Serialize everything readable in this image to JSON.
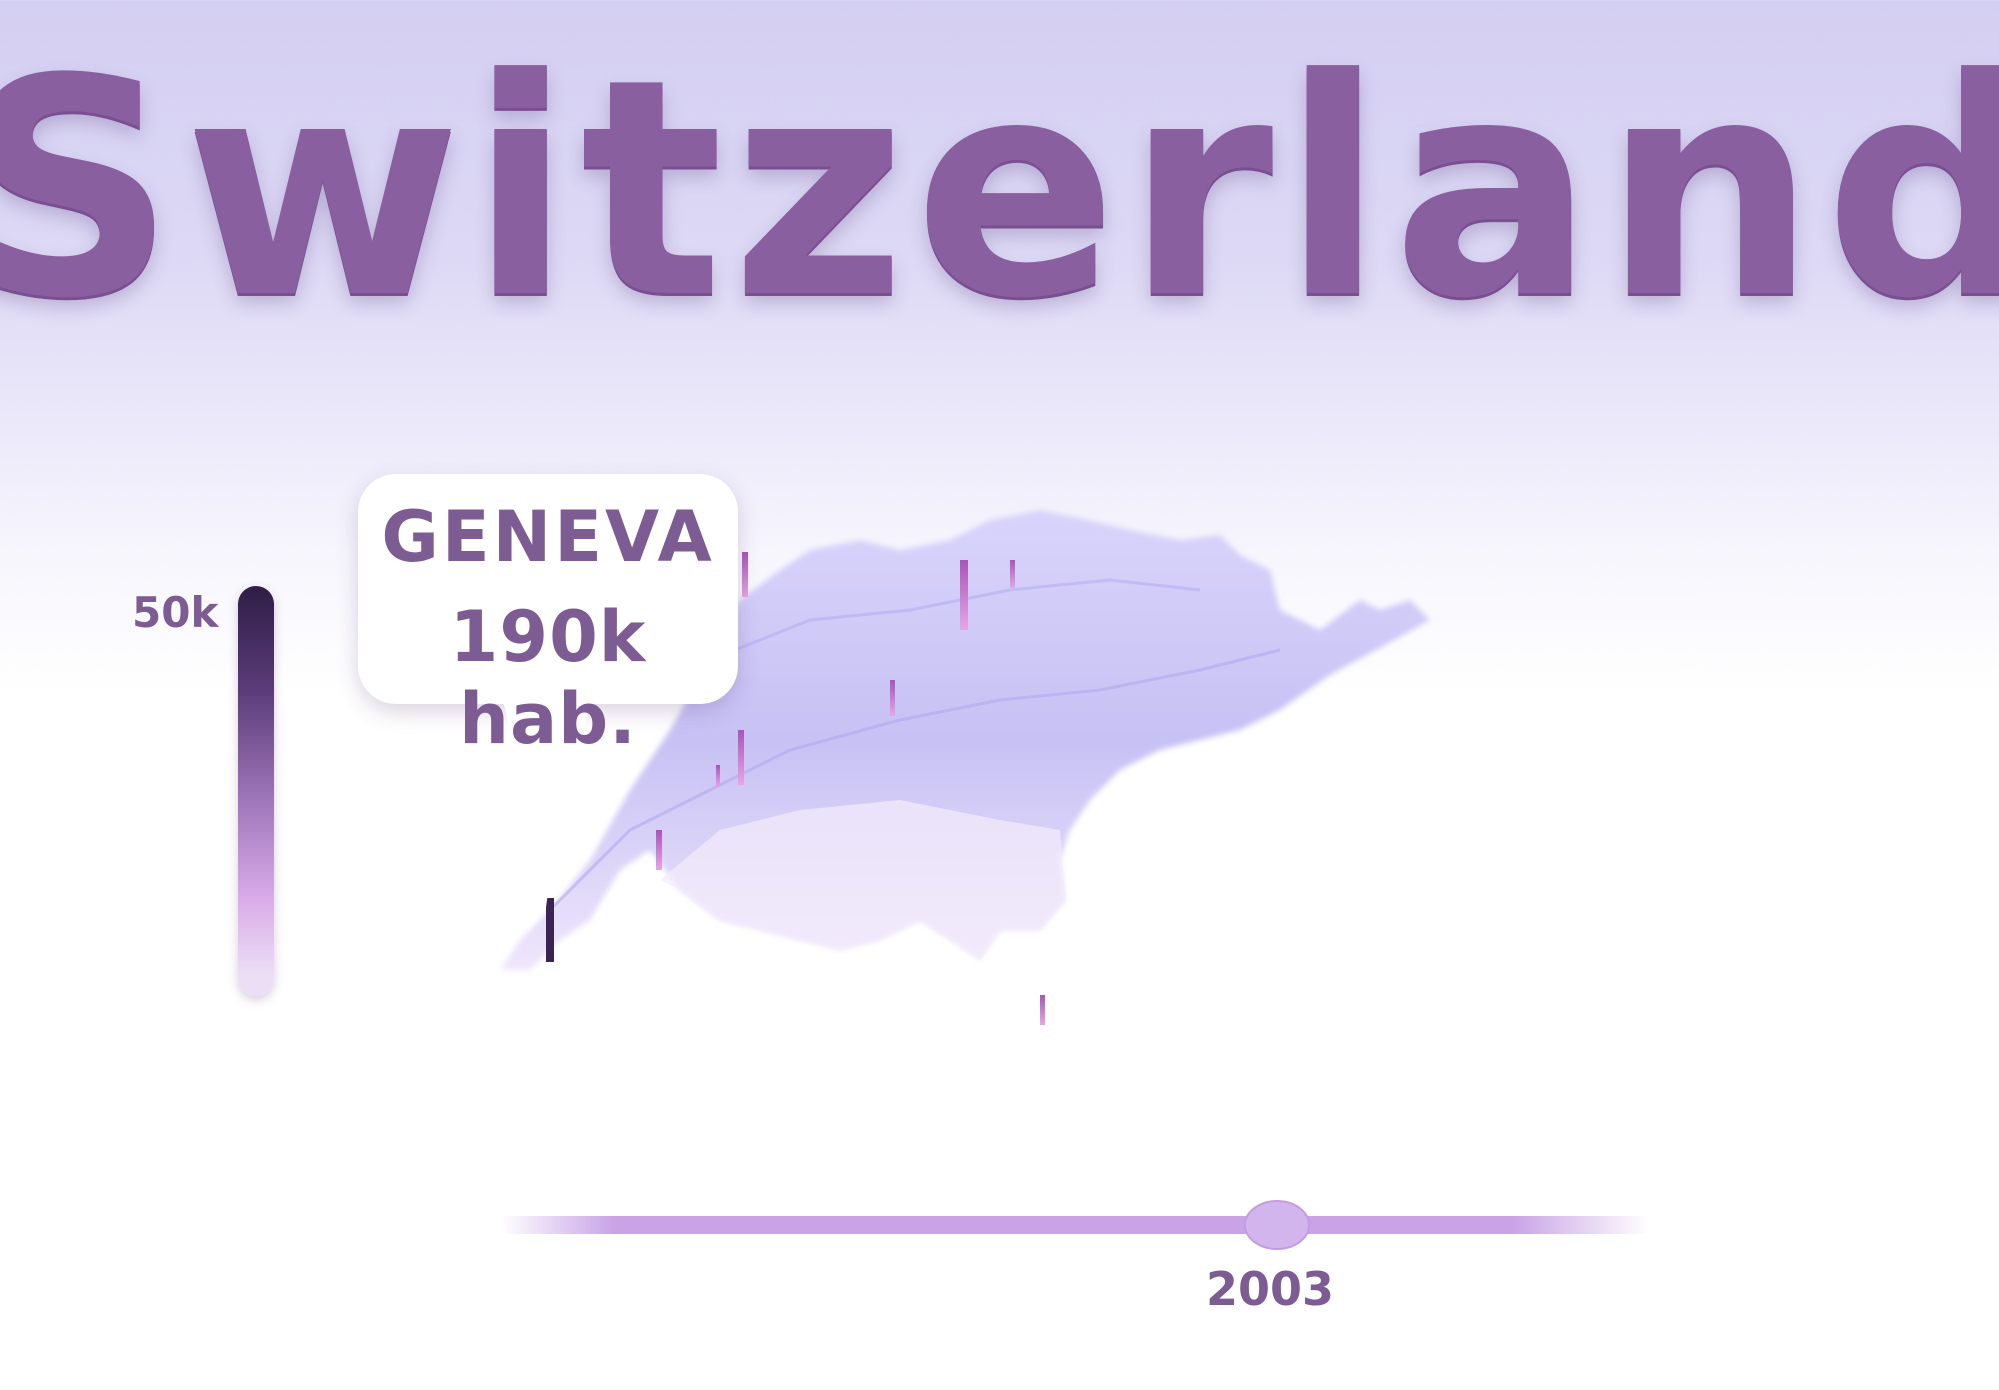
{
  "title": "Switzerland",
  "legend": {
    "max_label": "50k"
  },
  "callout": {
    "city": "GENEVA",
    "population": "190k hab."
  },
  "timeline": {
    "year": "2003"
  },
  "colors": {
    "title": "#8a5fa0",
    "text": "#7d5b93",
    "map_base": "#c9c3f3",
    "peak": "#d08ad8",
    "legend_dark": "#2e1d46",
    "legend_light": "#ecdff5",
    "slider": "#c9a3e6"
  }
}
